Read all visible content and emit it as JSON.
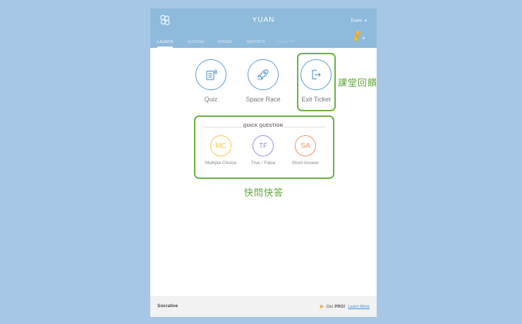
{
  "header": {
    "room_name": "YUAN",
    "user_label": "Event",
    "notification_count": "1"
  },
  "tabs": [
    {
      "label": "LAUNCH"
    },
    {
      "label": "QUIZZES"
    },
    {
      "label": "ROOMS"
    },
    {
      "label": "REPORTS"
    },
    {
      "label": "RESULTS"
    }
  ],
  "launch": {
    "quiz_label": "Quiz",
    "space_race_label": "Space Race",
    "exit_ticket_label": "Exit Ticket"
  },
  "quick_question": {
    "title": "QUICK QUESTION",
    "items": [
      {
        "abbr": "MC",
        "label": "Multiple Choice",
        "color": "#f2c94c"
      },
      {
        "abbr": "TF",
        "label": "True / False",
        "color": "#9b8fd6"
      },
      {
        "abbr": "SA",
        "label": "Short Answer",
        "color": "#f0925a"
      }
    ]
  },
  "footer": {
    "brand": "Socrative",
    "promo_prefix": "Get",
    "promo_pro": "PRO!",
    "learn_more": "Learn More"
  },
  "annotations": {
    "exit_ticket_note": "課堂回饋",
    "quick_question_note": "快問快答"
  },
  "colors": {
    "header_bg": "#8ebadc",
    "page_bg": "#a7c7e7",
    "accent_blue": "#5b9bd0",
    "highlight_green": "#6ab043"
  }
}
